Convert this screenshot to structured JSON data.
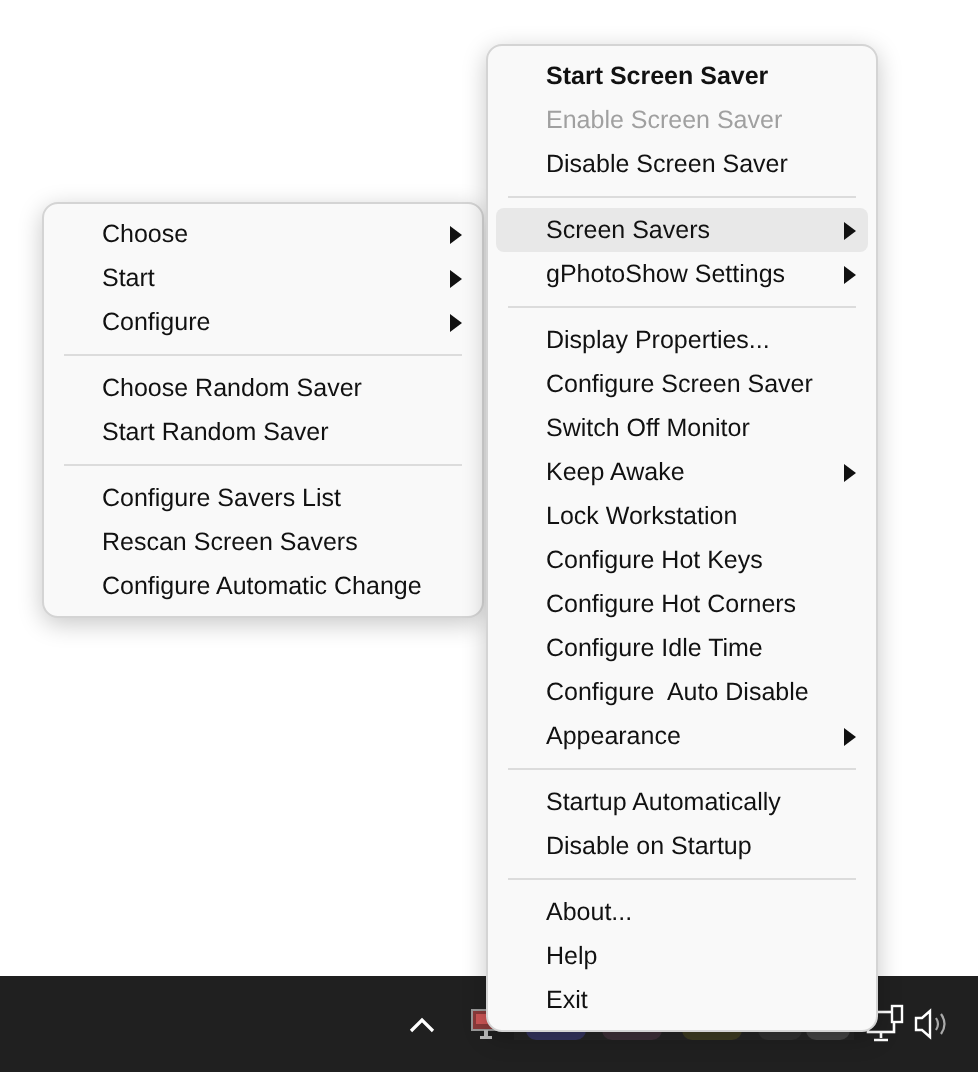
{
  "menus": [
    {
      "items": [
        {
          "kind": "item",
          "label": "Choose",
          "bold": false,
          "disabled": false,
          "selected": false,
          "submenu": true
        },
        {
          "kind": "item",
          "label": "Start",
          "bold": false,
          "disabled": false,
          "selected": false,
          "submenu": true
        },
        {
          "kind": "item",
          "label": "Configure",
          "bold": false,
          "disabled": false,
          "selected": false,
          "submenu": true
        },
        {
          "kind": "separator"
        },
        {
          "kind": "item",
          "label": "Choose Random Saver",
          "bold": false,
          "disabled": false,
          "selected": false,
          "submenu": false
        },
        {
          "kind": "item",
          "label": "Start Random Saver",
          "bold": false,
          "disabled": false,
          "selected": false,
          "submenu": false
        },
        {
          "kind": "separator"
        },
        {
          "kind": "item",
          "label": "Configure Savers List",
          "bold": false,
          "disabled": false,
          "selected": false,
          "submenu": false
        },
        {
          "kind": "item",
          "label": "Rescan Screen Savers",
          "bold": false,
          "disabled": false,
          "selected": false,
          "submenu": false
        },
        {
          "kind": "item",
          "label": "Configure Automatic Change",
          "bold": false,
          "disabled": false,
          "selected": false,
          "submenu": false
        }
      ]
    },
    {
      "items": [
        {
          "kind": "item",
          "label": "Start Screen Saver",
          "bold": true,
          "disabled": false,
          "selected": false,
          "submenu": false
        },
        {
          "kind": "item",
          "label": "Enable Screen Saver",
          "bold": false,
          "disabled": true,
          "selected": false,
          "submenu": false
        },
        {
          "kind": "item",
          "label": "Disable Screen Saver",
          "bold": false,
          "disabled": false,
          "selected": false,
          "submenu": false
        },
        {
          "kind": "separator"
        },
        {
          "kind": "item",
          "label": "Screen Savers",
          "bold": false,
          "disabled": false,
          "selected": true,
          "submenu": true
        },
        {
          "kind": "item",
          "label": "gPhotoShow Settings",
          "bold": false,
          "disabled": false,
          "selected": false,
          "submenu": true
        },
        {
          "kind": "separator"
        },
        {
          "kind": "item",
          "label": "Display Properties...",
          "bold": false,
          "disabled": false,
          "selected": false,
          "submenu": false
        },
        {
          "kind": "item",
          "label": "Configure Screen Saver",
          "bold": false,
          "disabled": false,
          "selected": false,
          "submenu": false
        },
        {
          "kind": "item",
          "label": "Switch Off Monitor",
          "bold": false,
          "disabled": false,
          "selected": false,
          "submenu": false
        },
        {
          "kind": "item",
          "label": "Keep Awake",
          "bold": false,
          "disabled": false,
          "selected": false,
          "submenu": true
        },
        {
          "kind": "item",
          "label": "Lock Workstation",
          "bold": false,
          "disabled": false,
          "selected": false,
          "submenu": false
        },
        {
          "kind": "item",
          "label": "Configure Hot Keys",
          "bold": false,
          "disabled": false,
          "selected": false,
          "submenu": false
        },
        {
          "kind": "item",
          "label": "Configure Hot Corners",
          "bold": false,
          "disabled": false,
          "selected": false,
          "submenu": false
        },
        {
          "kind": "item",
          "label": "Configure Idle Time",
          "bold": false,
          "disabled": false,
          "selected": false,
          "submenu": false
        },
        {
          "kind": "item",
          "label": "Configure  Auto Disable",
          "bold": false,
          "disabled": false,
          "selected": false,
          "submenu": false
        },
        {
          "kind": "item",
          "label": "Appearance",
          "bold": false,
          "disabled": false,
          "selected": false,
          "submenu": true
        },
        {
          "kind": "separator"
        },
        {
          "kind": "item",
          "label": "Startup Automatically",
          "bold": false,
          "disabled": false,
          "selected": false,
          "submenu": false
        },
        {
          "kind": "item",
          "label": "Disable on Startup",
          "bold": false,
          "disabled": false,
          "selected": false,
          "submenu": false
        },
        {
          "kind": "separator"
        },
        {
          "kind": "item",
          "label": "About...",
          "bold": false,
          "disabled": false,
          "selected": false,
          "submenu": false
        },
        {
          "kind": "item",
          "label": "Help",
          "bold": false,
          "disabled": false,
          "selected": false,
          "submenu": false
        },
        {
          "kind": "item",
          "label": "Exit",
          "bold": false,
          "disabled": false,
          "selected": false,
          "submenu": false
        }
      ]
    }
  ]
}
